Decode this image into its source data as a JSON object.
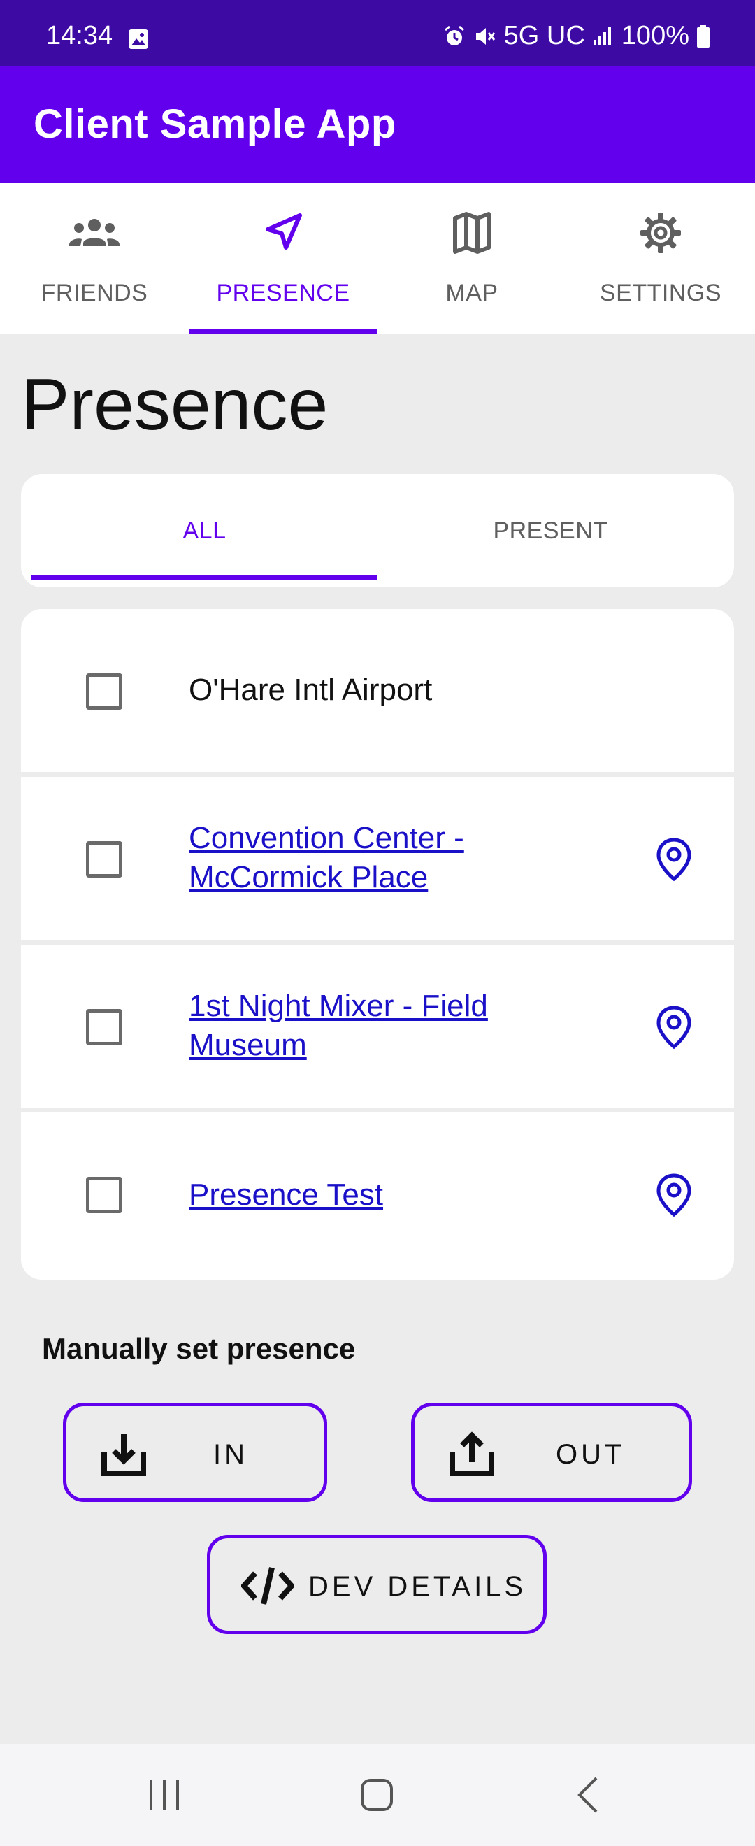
{
  "status": {
    "time": "14:34",
    "network": "5G UC",
    "battery": "100%"
  },
  "app": {
    "title": "Client Sample App"
  },
  "tabs": [
    {
      "label": "FRIENDS",
      "icon": "people-icon",
      "active": false
    },
    {
      "label": "PRESENCE",
      "icon": "navigation-arrow-icon",
      "active": true
    },
    {
      "label": "MAP",
      "icon": "map-icon",
      "active": false
    },
    {
      "label": "SETTINGS",
      "icon": "gear-icon",
      "active": false
    }
  ],
  "page": {
    "title": "Presence"
  },
  "filter": {
    "tabs": [
      {
        "label": "ALL",
        "active": true
      },
      {
        "label": "PRESENT",
        "active": false
      }
    ]
  },
  "locations": [
    {
      "name": "O'Hare Intl Airport",
      "link": false,
      "checked": false,
      "has_pin": false
    },
    {
      "name": "Convention Center - McCormick Place",
      "link": true,
      "checked": false,
      "has_pin": true
    },
    {
      "name": "1st Night Mixer - Field Museum",
      "link": true,
      "checked": false,
      "has_pin": true
    },
    {
      "name": "Presence Test",
      "link": true,
      "checked": false,
      "has_pin": true
    }
  ],
  "manual": {
    "label": "Manually set presence",
    "in_label": "IN",
    "out_label": "OUT",
    "dev_label": "DEV DETAILS"
  },
  "colors": {
    "primary": "#6200ee",
    "status_bar": "#3d0aa3",
    "link": "#1a10c8",
    "background": "#ececec"
  }
}
